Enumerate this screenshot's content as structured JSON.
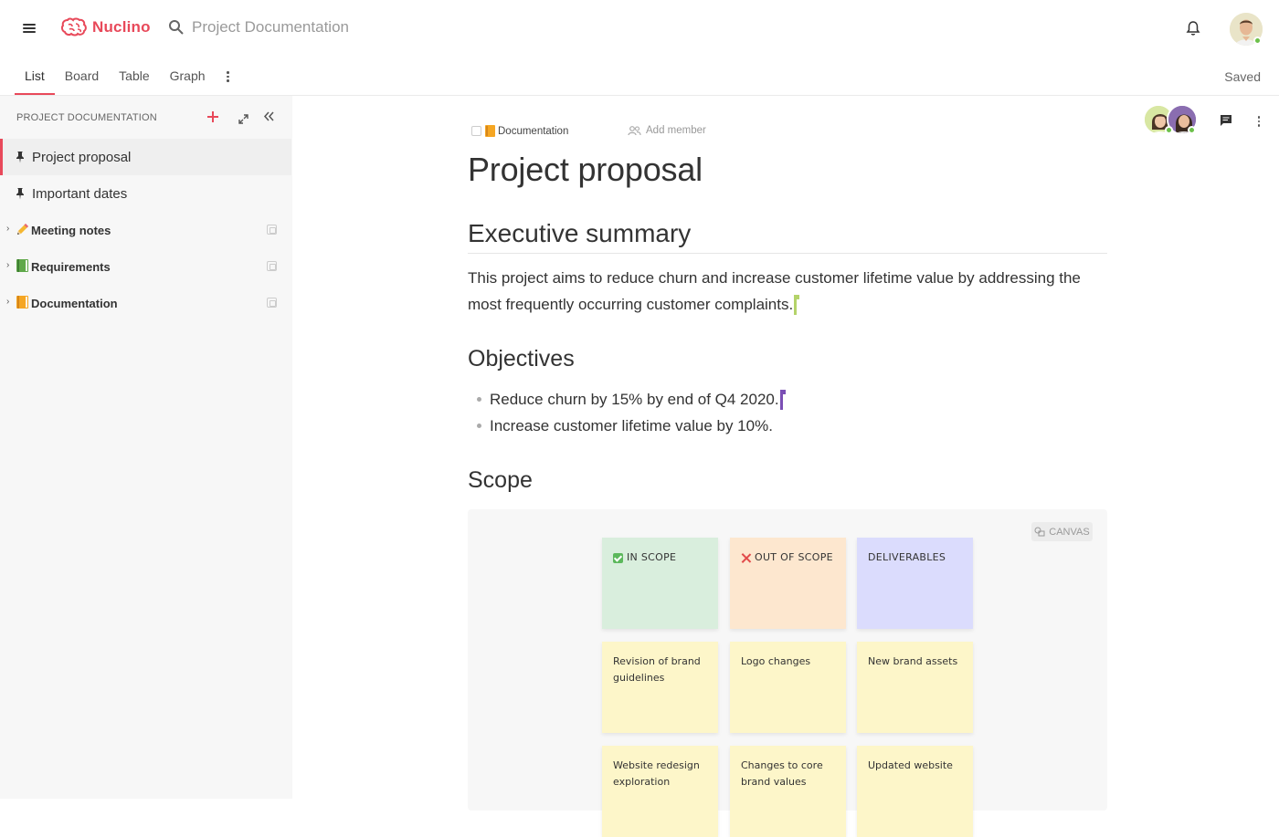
{
  "app": {
    "name": "Nuclino"
  },
  "search": {
    "label": "Project Documentation"
  },
  "tabs": [
    {
      "label": "List",
      "active": true
    },
    {
      "label": "Board",
      "active": false
    },
    {
      "label": "Table",
      "active": false
    },
    {
      "label": "Graph",
      "active": false
    }
  ],
  "status": {
    "saved": "Saved"
  },
  "sidebar": {
    "header": "PROJECT DOCUMENTATION",
    "items": [
      {
        "label": "Project proposal",
        "icon": "pin-icon",
        "active": true
      },
      {
        "label": "Important dates",
        "icon": "pin-icon",
        "active": false
      },
      {
        "label": "Meeting notes",
        "icon": "pencil-emoji-icon",
        "expandable": true
      },
      {
        "label": "Requirements",
        "icon": "green-book-icon",
        "expandable": true
      },
      {
        "label": "Documentation",
        "icon": "orange-book-icon",
        "expandable": true
      }
    ]
  },
  "document": {
    "collection": "Documentation",
    "add_member": "Add member",
    "title": "Project proposal",
    "sections": {
      "executive_summary": {
        "heading": "Executive summary",
        "text": "This project aims to reduce churn and increase customer lifetime value by addressing the most frequently occurring customer complaints."
      },
      "objectives": {
        "heading": "Objectives",
        "items": [
          "Reduce churn by 15% by end of Q4 2020.",
          "Increase customer lifetime value by 10%."
        ]
      },
      "scope": {
        "heading": "Scope",
        "canvas_badge": "CANVAS",
        "columns": [
          {
            "header": "IN SCOPE",
            "color": "#d9eedd",
            "notes": [
              "Revision of brand guidelines",
              "Website redesign exploration"
            ]
          },
          {
            "header": "OUT OF SCOPE",
            "color": "#fde7cf",
            "notes": [
              "Logo changes",
              "Changes to core brand values"
            ]
          },
          {
            "header": "DELIVERABLES",
            "color": "#dbdcfd",
            "notes": [
              "New brand assets",
              "Updated website"
            ]
          }
        ]
      }
    }
  },
  "colors": {
    "accent": "#e8495a",
    "online": "#6cc04a",
    "cursor_green": "#b4d36a",
    "cursor_purple": "#7b4fb5"
  }
}
